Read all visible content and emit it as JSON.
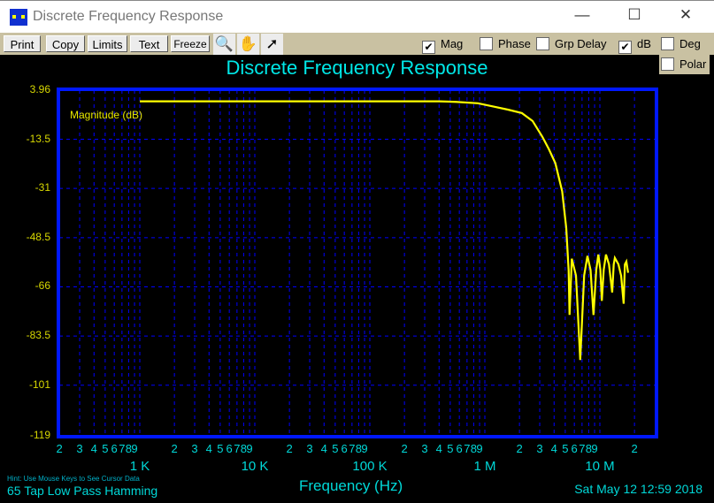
{
  "window": {
    "title": "Discrete Frequency Response",
    "minimize": "—",
    "maximize": "☐",
    "close": "✕"
  },
  "toolbar": {
    "buttons": [
      "Print",
      "Copy",
      "Limits",
      "Text",
      "Freeze"
    ],
    "tools": [
      {
        "icon": "zoom-icon",
        "glyph": "🔍"
      },
      {
        "icon": "hand-pan-icon",
        "glyph": "✋"
      },
      {
        "icon": "pointer-arrow-icon",
        "glyph": "➚"
      }
    ],
    "checkboxes": [
      {
        "label": "Mag",
        "checked": true
      },
      {
        "label": "Phase",
        "checked": false
      },
      {
        "label": "Grp Delay",
        "checked": false
      },
      {
        "label": "dB",
        "checked": true
      },
      {
        "label": "Deg",
        "checked": false
      },
      {
        "label": "Polar",
        "checked": false
      }
    ]
  },
  "footer": {
    "hint": "Hint: Use Mouse Keys to See Cursor Data",
    "filter": "65 Tap Low Pass Hamming",
    "date": "Sat May 12 12:59 2018"
  },
  "colors": {
    "curve": "#ffff00",
    "grid": "#0000ff",
    "frame": "#0018ff",
    "text": "#00e0e0"
  },
  "chart_data": {
    "type": "line",
    "title": "Discrete Frequency Response",
    "xlabel": "Frequency (Hz)",
    "ylabel": "Magnitude (dB)",
    "xscale": "log",
    "xlim": [
      200,
      30000000
    ],
    "ylim": [
      -119,
      3.96
    ],
    "grid": true,
    "yticks": [
      "3.96",
      "-13.5",
      "-31",
      "-48.5",
      "-66",
      "-83.5",
      "-101",
      "-119"
    ],
    "ytick_values": [
      3.96,
      -13.5,
      -31,
      -48.5,
      -66,
      -83.5,
      -101,
      -119
    ],
    "xtick_minor_labels": [
      "2",
      "3",
      "4",
      "5",
      "6",
      "7",
      "8",
      "9"
    ],
    "xtick_decades": [
      {
        "value": 1000,
        "label": "1 K"
      },
      {
        "value": 10000,
        "label": "10 K"
      },
      {
        "value": 100000,
        "label": "100 K"
      },
      {
        "value": 1000000,
        "label": "1 M"
      },
      {
        "value": 10000000,
        "label": "10 M"
      }
    ],
    "series": [
      {
        "name": "Magnitude (dB)",
        "x": [
          1000,
          10000,
          100000,
          400000,
          560000,
          870000,
          1230000,
          1600000,
          2100000,
          2600000,
          3160000,
          3600000,
          4100000,
          4700000,
          5100000,
          5350000,
          5450000,
          5700000,
          6200000,
          6750000,
          7300000,
          7800000,
          8300000,
          8800000,
          9300000,
          9700000,
          10100000,
          10400000,
          10800000,
          11300000,
          12000000,
          12800000,
          13200000,
          13500000,
          14500000,
          15300000,
          16100000,
          16500000,
          17000000,
          17600000
        ],
        "y": [
          0,
          0,
          0,
          0,
          -0.2,
          -0.7,
          -2,
          -3,
          -4.2,
          -7,
          -12.6,
          -17,
          -22,
          -32,
          -45,
          -60,
          -76,
          -56,
          -62,
          -92,
          -62,
          -55,
          -60,
          -76,
          -60,
          -54.5,
          -60,
          -71,
          -60,
          -54.5,
          -58,
          -68,
          -58,
          -55.7,
          -58,
          -62,
          -72,
          -58,
          -57,
          -61
        ]
      }
    ]
  }
}
